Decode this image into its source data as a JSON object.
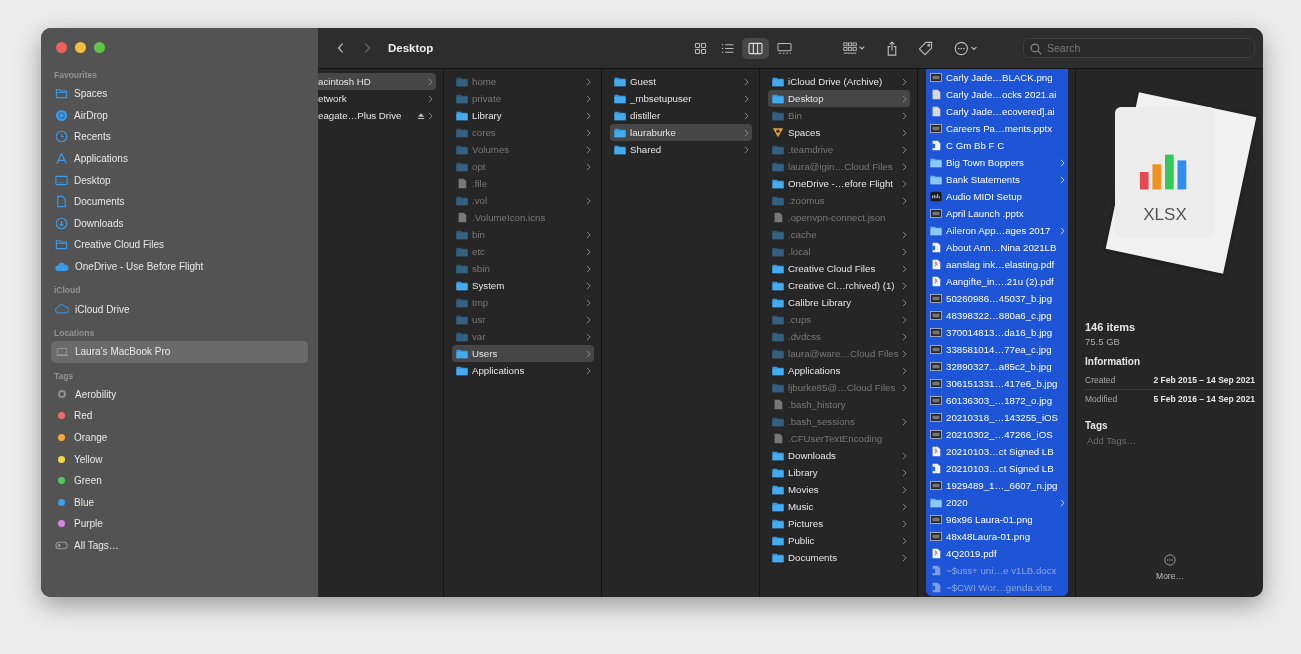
{
  "toolbar": {
    "title": "Desktop",
    "views": [
      {
        "kind": "icons",
        "selected": false
      },
      {
        "kind": "list",
        "selected": false
      },
      {
        "kind": "columns",
        "selected": true
      },
      {
        "kind": "gallery",
        "selected": false
      }
    ],
    "search": {
      "placeholder": "Search"
    }
  },
  "sidebar": {
    "sections": [
      {
        "title": "Favourites",
        "items": [
          {
            "label": "Spaces",
            "kind": "folder",
            "selected": false
          },
          {
            "label": "AirDrop",
            "kind": "airdrop",
            "selected": false
          },
          {
            "label": "Recents",
            "kind": "clock",
            "selected": false
          },
          {
            "label": "Applications",
            "kind": "apps",
            "selected": false
          },
          {
            "label": "Desktop",
            "kind": "desktop",
            "selected": false
          },
          {
            "label": "Documents",
            "kind": "document",
            "selected": false
          },
          {
            "label": "Downloads",
            "kind": "download",
            "selected": false
          },
          {
            "label": "Creative Cloud Files",
            "kind": "folder",
            "selected": false
          },
          {
            "label": "OneDrive - Use Before Flight",
            "kind": "cloud-solid",
            "selected": false
          }
        ]
      },
      {
        "title": "iCloud",
        "items": [
          {
            "label": "iCloud Drive",
            "kind": "cloud",
            "selected": false
          }
        ]
      },
      {
        "title": "Locations",
        "items": [
          {
            "label": "Laura’s MacBook Pro",
            "kind": "laptop",
            "selected": true
          }
        ]
      },
      {
        "title": "Tags",
        "items": [
          {
            "label": "Aerobility",
            "kind": "tag-outline",
            "color": "#8e8e8e",
            "selected": false
          },
          {
            "label": "Red",
            "kind": "tag",
            "color": "#f06d6a",
            "selected": false
          },
          {
            "label": "Orange",
            "kind": "tag",
            "color": "#f2a93b",
            "selected": false
          },
          {
            "label": "Yellow",
            "kind": "tag",
            "color": "#f5d547",
            "selected": false
          },
          {
            "label": "Green",
            "kind": "tag",
            "color": "#4cce5c",
            "selected": false
          },
          {
            "label": "Blue",
            "kind": "tag",
            "color": "#3aa1f0",
            "selected": false
          },
          {
            "label": "Purple",
            "kind": "tag",
            "color": "#d884e6",
            "selected": false
          },
          {
            "label": "All Tags…",
            "kind": "all-tags",
            "selected": false
          }
        ]
      }
    ]
  },
  "columns": [
    {
      "focused": false,
      "items": [
        {
          "name": "acintosh HD",
          "kind": "drive",
          "dimmed": false,
          "selected": true
        },
        {
          "name": "etwork",
          "kind": "network",
          "dimmed": false,
          "selected": false
        },
        {
          "name": "eagate…Plus Drive",
          "kind": "external",
          "dimmed": false,
          "selected": false
        }
      ]
    },
    {
      "focused": false,
      "items": [
        {
          "name": "home",
          "kind": "folder",
          "dimmed": true,
          "selected": false
        },
        {
          "name": "private",
          "kind": "folder",
          "dimmed": true,
          "selected": false
        },
        {
          "name": "Library",
          "kind": "folder",
          "dimmed": false,
          "selected": false
        },
        {
          "name": "cores",
          "kind": "folder",
          "dimmed": true,
          "selected": false
        },
        {
          "name": "Volumes",
          "kind": "folder",
          "dimmed": true,
          "selected": false
        },
        {
          "name": "opt",
          "kind": "folder",
          "dimmed": true,
          "selected": false
        },
        {
          "name": ".file",
          "kind": "file",
          "dimmed": true,
          "selected": false
        },
        {
          "name": ".vol",
          "kind": "folder",
          "dimmed": true,
          "selected": false
        },
        {
          "name": ".VolumeIcon.icns",
          "kind": "file",
          "dimmed": true,
          "selected": false
        },
        {
          "name": "bin",
          "kind": "folder",
          "dimmed": true,
          "selected": false
        },
        {
          "name": "etc",
          "kind": "folder",
          "dimmed": true,
          "selected": false
        },
        {
          "name": "sbin",
          "kind": "folder",
          "dimmed": true,
          "selected": false
        },
        {
          "name": "System",
          "kind": "folder",
          "dimmed": false,
          "selected": false
        },
        {
          "name": "tmp",
          "kind": "folder",
          "dimmed": true,
          "selected": false
        },
        {
          "name": "usr",
          "kind": "folder",
          "dimmed": true,
          "selected": false
        },
        {
          "name": "var",
          "kind": "folder",
          "dimmed": true,
          "selected": false
        },
        {
          "name": "Users",
          "kind": "folder",
          "dimmed": false,
          "selected": true
        },
        {
          "name": "Applications",
          "kind": "folder",
          "dimmed": false,
          "selected": false
        }
      ]
    },
    {
      "focused": false,
      "items": [
        {
          "name": "Guest",
          "kind": "folder",
          "dimmed": false,
          "selected": false
        },
        {
          "name": "_mbsetupuser",
          "kind": "folder",
          "dimmed": false,
          "selected": false
        },
        {
          "name": "distiller",
          "kind": "folder",
          "dimmed": false,
          "selected": false
        },
        {
          "name": "lauraburke",
          "kind": "folder",
          "dimmed": false,
          "selected": true
        },
        {
          "name": "Shared",
          "kind": "folder",
          "dimmed": false,
          "selected": false
        }
      ]
    },
    {
      "focused": false,
      "items": [
        {
          "name": "iCloud Drive (Archive)",
          "kind": "folder",
          "dimmed": false,
          "selected": false
        },
        {
          "name": "Desktop",
          "kind": "folder",
          "dimmed": false,
          "selected": true
        },
        {
          "name": "Bin",
          "kind": "folder",
          "dimmed": true,
          "selected": false
        },
        {
          "name": "Spaces",
          "kind": "package",
          "dimmed": false,
          "selected": false
        },
        {
          "name": ".teamdrive",
          "kind": "folder",
          "dimmed": true,
          "selected": false
        },
        {
          "name": "laura@igin…Cloud Files",
          "kind": "folder",
          "dimmed": true,
          "selected": false
        },
        {
          "name": "OneDrive -…efore Flight",
          "kind": "folder",
          "dimmed": false,
          "selected": false
        },
        {
          "name": ".zoomus",
          "kind": "folder",
          "dimmed": true,
          "selected": false
        },
        {
          "name": ".openvpn-connect.json",
          "kind": "file",
          "dimmed": true,
          "selected": false
        },
        {
          "name": ".cache",
          "kind": "folder",
          "dimmed": true,
          "selected": false
        },
        {
          "name": ".local",
          "kind": "folder",
          "dimmed": true,
          "selected": false
        },
        {
          "name": "Creative Cloud Files",
          "kind": "folder",
          "dimmed": false,
          "selected": false
        },
        {
          "name": "Creative Cl…rchived) (1)",
          "kind": "folder",
          "dimmed": false,
          "selected": false
        },
        {
          "name": "Calibre Library",
          "kind": "folder",
          "dimmed": false,
          "selected": false
        },
        {
          "name": ".cups",
          "kind": "folder",
          "dimmed": true,
          "selected": false
        },
        {
          "name": ".dvdcss",
          "kind": "folder",
          "dimmed": true,
          "selected": false
        },
        {
          "name": "laura@ware…Cloud Files",
          "kind": "folder",
          "dimmed": true,
          "selected": false
        },
        {
          "name": "Applications",
          "kind": "folder",
          "dimmed": false,
          "selected": false
        },
        {
          "name": "ljburke85@…Cloud Files",
          "kind": "folder",
          "dimmed": true,
          "selected": false
        },
        {
          "name": ".bash_history",
          "kind": "file",
          "dimmed": true,
          "selected": false
        },
        {
          "name": ".bash_sessions",
          "kind": "folder",
          "dimmed": true,
          "selected": false
        },
        {
          "name": ".CFUserTextEncoding",
          "kind": "file",
          "dimmed": true,
          "selected": false
        },
        {
          "name": "Downloads",
          "kind": "folder",
          "dimmed": false,
          "selected": false
        },
        {
          "name": "Library",
          "kind": "folder",
          "dimmed": false,
          "selected": false
        },
        {
          "name": "Movies",
          "kind": "folder",
          "dimmed": false,
          "selected": false
        },
        {
          "name": "Music",
          "kind": "folder",
          "dimmed": false,
          "selected": false
        },
        {
          "name": "Pictures",
          "kind": "folder",
          "dimmed": false,
          "selected": false
        },
        {
          "name": "Public",
          "kind": "folder",
          "dimmed": false,
          "selected": false
        },
        {
          "name": "Documents",
          "kind": "folder",
          "dimmed": false,
          "selected": false
        }
      ]
    },
    {
      "focused": true,
      "items": [
        {
          "name": "Carly Jade…BLACK.png",
          "kind": "image",
          "dimmed": false,
          "selected": true
        },
        {
          "name": "Carly Jade…ocks 2021.ai",
          "kind": "file",
          "dimmed": false,
          "selected": true
        },
        {
          "name": "Carly Jade…ecovered].ai",
          "kind": "file",
          "dimmed": false,
          "selected": true
        },
        {
          "name": "Careers Pa…ments.pptx",
          "kind": "image",
          "dimmed": false,
          "selected": true
        },
        {
          "name": "C Gm Bb F C",
          "kind": "doc",
          "dimmed": false,
          "selected": true
        },
        {
          "name": "Big Town Boppers",
          "kind": "folder",
          "dimmed": false,
          "selected": true
        },
        {
          "name": "Bank Statements",
          "kind": "folder",
          "dimmed": false,
          "selected": true
        },
        {
          "name": "Audio MIDI Setup",
          "kind": "app",
          "dimmed": false,
          "selected": true
        },
        {
          "name": "April Launch .pptx",
          "kind": "image",
          "dimmed": false,
          "selected": true
        },
        {
          "name": "Aileron App…ages 2017",
          "kind": "folder",
          "dimmed": false,
          "selected": true
        },
        {
          "name": "About Ann…Nina 2021LB",
          "kind": "doc",
          "dimmed": false,
          "selected": true
        },
        {
          "name": "aanslag ink…elasting.pdf",
          "kind": "pdf",
          "dimmed": false,
          "selected": true
        },
        {
          "name": "Aangifte_in….21u (2).pdf",
          "kind": "pdf",
          "dimmed": false,
          "selected": true
        },
        {
          "name": "50260986…45037_b.jpg",
          "kind": "image",
          "dimmed": false,
          "selected": true
        },
        {
          "name": "48398322…880a6_c.jpg",
          "kind": "image",
          "dimmed": false,
          "selected": true
        },
        {
          "name": "370014813…da16_b.jpg",
          "kind": "image",
          "dimmed": false,
          "selected": true
        },
        {
          "name": "338581014…77ea_c.jpg",
          "kind": "image",
          "dimmed": false,
          "selected": true
        },
        {
          "name": "32890327…a85c2_b.jpg",
          "kind": "image",
          "dimmed": false,
          "selected": true
        },
        {
          "name": "306151331…417e6_b.jpg",
          "kind": "image",
          "dimmed": false,
          "selected": true
        },
        {
          "name": "60136303_…1872_o.jpg",
          "kind": "image",
          "dimmed": false,
          "selected": true
        },
        {
          "name": "20210318_…143255_iOS",
          "kind": "image",
          "dimmed": false,
          "selected": true
        },
        {
          "name": "20210302_…47266_iOS",
          "kind": "image",
          "dimmed": false,
          "selected": true
        },
        {
          "name": "20210103…ct Signed LB",
          "kind": "pdf",
          "dimmed": false,
          "selected": true
        },
        {
          "name": "20210103…ct Signed LB",
          "kind": "doc",
          "dimmed": false,
          "selected": true
        },
        {
          "name": "1929489_1…_6607_n.jpg",
          "kind": "image",
          "dimmed": false,
          "selected": true
        },
        {
          "name": "2020",
          "kind": "folder",
          "dimmed": false,
          "selected": true
        },
        {
          "name": "96x96 Laura-01.png",
          "kind": "image",
          "dimmed": false,
          "selected": true
        },
        {
          "name": "48x48Laura-01.png",
          "kind": "image",
          "dimmed": false,
          "selected": true
        },
        {
          "name": "4Q2019.pdf",
          "kind": "pdf",
          "dimmed": false,
          "selected": true
        },
        {
          "name": "~$uss+ uni…e v1LB.docx",
          "kind": "doc",
          "dimmed": true,
          "selected": true
        },
        {
          "name": "~$CWI Wor…genda.xlsx",
          "kind": "doc",
          "dimmed": true,
          "selected": true
        }
      ]
    }
  ],
  "preview": {
    "file_label": "XLSX",
    "count": "146 items",
    "size": "75.5 GB",
    "info_title": "Information",
    "info": [
      {
        "label": "Created",
        "value": "2 Feb 2015 – 14 Sep 2021"
      },
      {
        "label": "Modified",
        "value": "5 Feb 2016 – 14 Sep 2021"
      }
    ],
    "tags_title": "Tags",
    "tags_placeholder": "Add Tags…",
    "more": "More…"
  }
}
